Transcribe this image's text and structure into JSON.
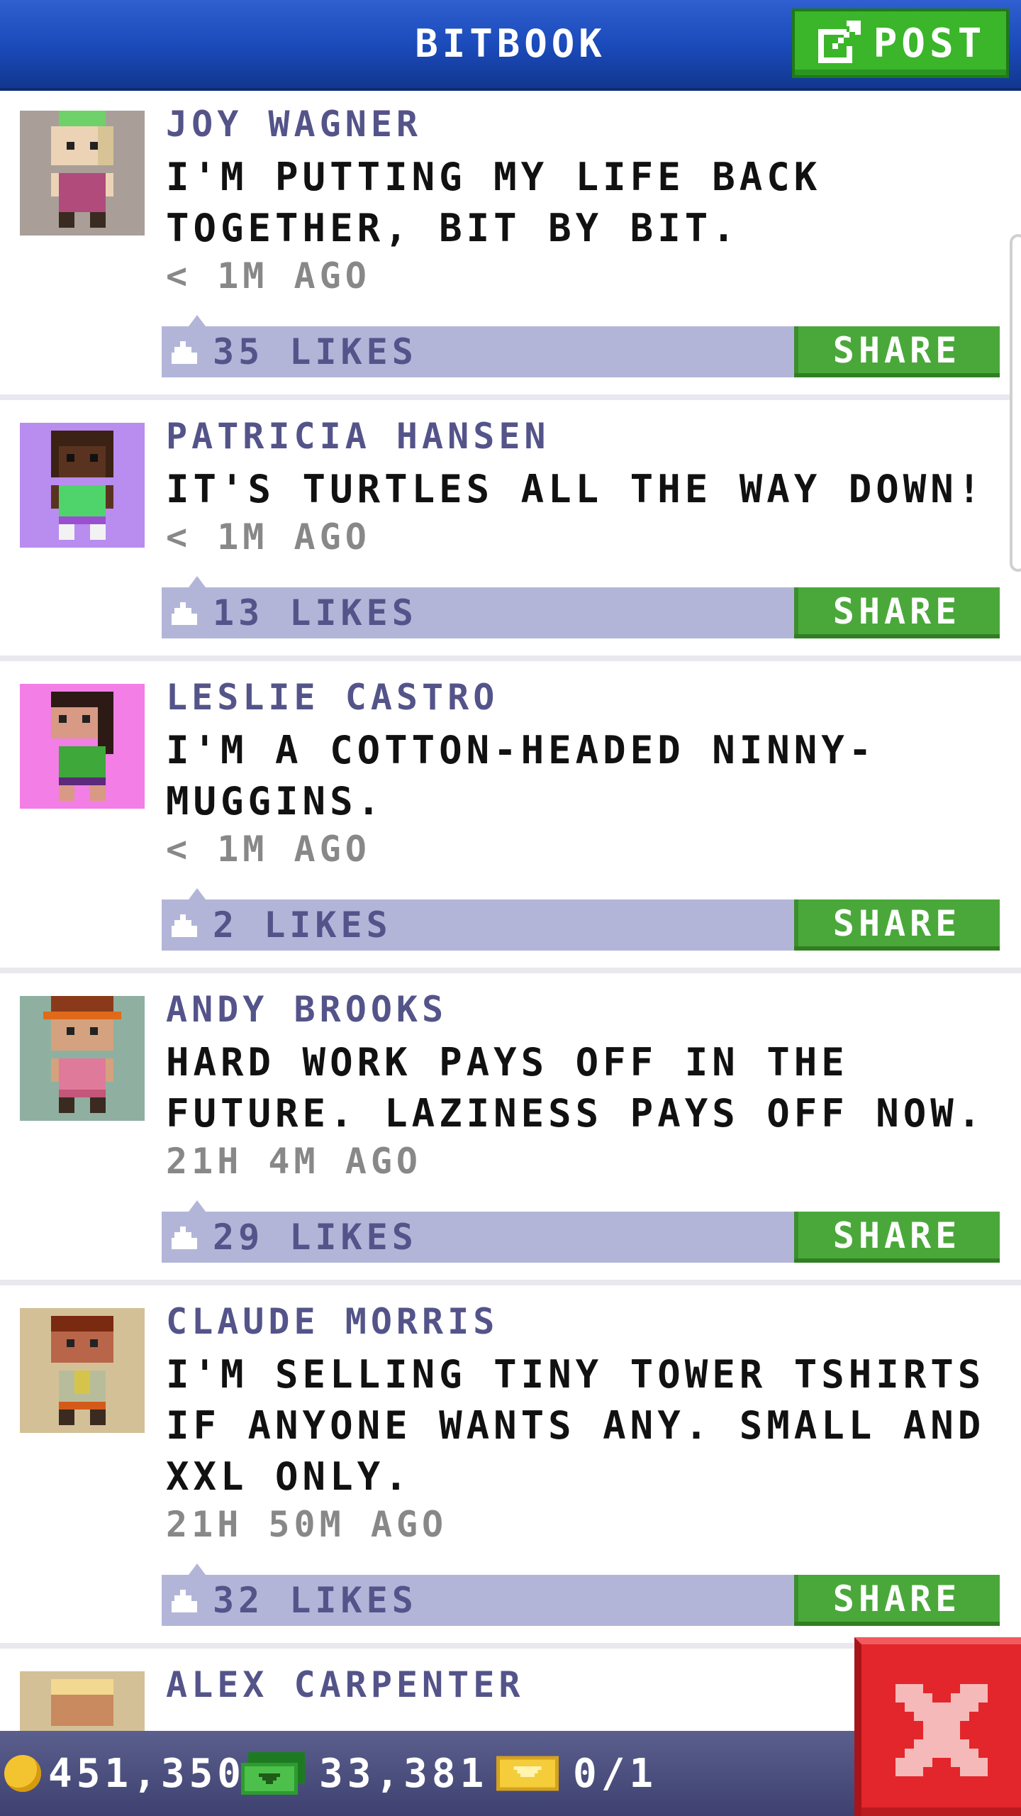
{
  "header": {
    "title": "BITBOOK",
    "post_label": "POST",
    "post_icon": "edit-icon"
  },
  "posts": [
    {
      "name": "JOY WAGNER",
      "text": "I'M PUTTING MY LIFE BACK TOGETHER, BIT BY BIT.",
      "time": "< 1M AGO",
      "likes": "35 LIKES",
      "share": "SHARE",
      "avatar_bg": "#a99f98"
    },
    {
      "name": "PATRICIA HANSEN",
      "text": "IT'S TURTLES ALL THE WAY DOWN!",
      "time": "< 1M AGO",
      "likes": "13 LIKES",
      "share": "SHARE",
      "avatar_bg": "#b98cf0"
    },
    {
      "name": "LESLIE CASTRO",
      "text": "I'M A COTTON-HEADED NINNY-MUGGINS.",
      "time": "< 1M AGO",
      "likes": "2 LIKES",
      "share": "SHARE",
      "avatar_bg": "#f27ee6"
    },
    {
      "name": "ANDY BROOKS",
      "text": "HARD WORK PAYS OFF IN THE FUTURE. LAZINESS PAYS OFF NOW.",
      "time": "21H 4M AGO",
      "likes": "29 LIKES",
      "share": "SHARE",
      "avatar_bg": "#8fb0a0"
    },
    {
      "name": "CLAUDE MORRIS",
      "text": "I'M SELLING TINY TOWER TSHIRTS IF ANYONE WANTS ANY. SMALL AND XXL ONLY.",
      "time": "21H 50M AGO",
      "likes": "32 LIKES",
      "share": "SHARE",
      "avatar_bg": "#d4c097"
    },
    {
      "name": "ALEX CARPENTER",
      "avatar_bg": "#d4c097"
    }
  ],
  "status": {
    "coins": "451,350",
    "bux": "33,381",
    "tickets": "0/1"
  },
  "colors": {
    "header": "#1a49b8",
    "green": "#3bb52a",
    "like_bar": "#b3b5d8",
    "name": "#54548a",
    "close": "#e3262b"
  }
}
